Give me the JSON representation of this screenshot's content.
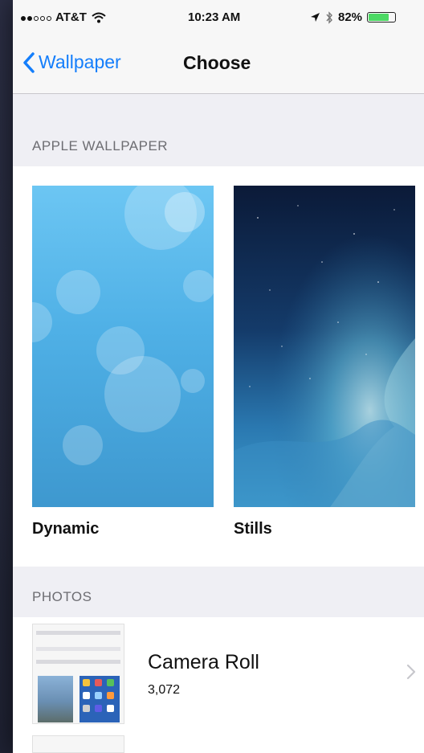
{
  "status_bar": {
    "carrier": "AT&T",
    "time": "10:23 AM",
    "battery": "82%",
    "battery_level": 0.82
  },
  "nav": {
    "back_label": "Wallpaper",
    "title": "Choose"
  },
  "sections": {
    "apple_wallpaper": "APPLE WALLPAPER",
    "photos": "PHOTOS"
  },
  "wallpapers": [
    {
      "label": "Dynamic"
    },
    {
      "label": "Stills"
    }
  ],
  "albums": [
    {
      "name": "Camera Roll",
      "count": "3,072"
    }
  ],
  "colors": {
    "accent": "#147efb",
    "battery_fill": "#4cd964"
  },
  "icons": {
    "back": "chevron-left-icon",
    "disclosure": "chevron-right-icon",
    "wifi": "wifi-icon",
    "location": "location-arrow-icon",
    "bluetooth": "bluetooth-icon",
    "battery": "battery-icon"
  }
}
